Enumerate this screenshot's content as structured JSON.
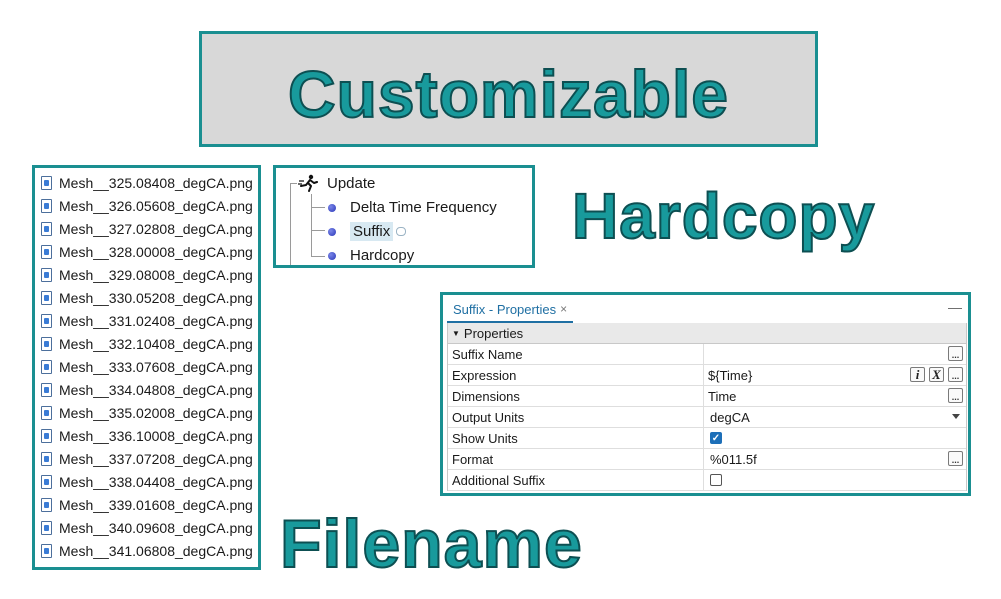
{
  "headings": {
    "title": "Customizable",
    "hardcopy": "Hardcopy",
    "filename": "Filename"
  },
  "files": [
    "Mesh__325.08408_degCA.png",
    "Mesh__326.05608_degCA.png",
    "Mesh__327.02808_degCA.png",
    "Mesh__328.00008_degCA.png",
    "Mesh__329.08008_degCA.png",
    "Mesh__330.05208_degCA.png",
    "Mesh__331.02408_degCA.png",
    "Mesh__332.10408_degCA.png",
    "Mesh__333.07608_degCA.png",
    "Mesh__334.04808_degCA.png",
    "Mesh__335.02008_degCA.png",
    "Mesh__336.10008_degCA.png",
    "Mesh__337.07208_degCA.png",
    "Mesh__338.04408_degCA.png",
    "Mesh__339.01608_degCA.png",
    "Mesh__340.09608_degCA.png",
    "Mesh__341.06808_degCA.png"
  ],
  "tree": {
    "root": "Update",
    "children": [
      "Delta Time Frequency",
      "Suffix",
      "Hardcopy"
    ],
    "selected": "Suffix"
  },
  "properties": {
    "tab_label": "Suffix - Properties",
    "tab_close": "×",
    "minimize": "—",
    "group_label": "Properties",
    "rows": [
      {
        "name": "Suffix Name",
        "value": ""
      },
      {
        "name": "Expression",
        "value": "${Time}"
      },
      {
        "name": "Dimensions",
        "value": "Time"
      },
      {
        "name": "Output Units",
        "value": "degCA"
      },
      {
        "name": "Show Units",
        "value": "true"
      },
      {
        "name": "Format",
        "value": "%011.5f"
      },
      {
        "name": "Additional Suffix",
        "value": "false"
      }
    ],
    "dots_label": "...",
    "i_label": "i",
    "x_label": "X"
  },
  "colors": {
    "accent": "#1a8f91",
    "big_text": "#189a9c",
    "title_bg": "#d8d8d8",
    "selection": "#d8e9f2"
  }
}
